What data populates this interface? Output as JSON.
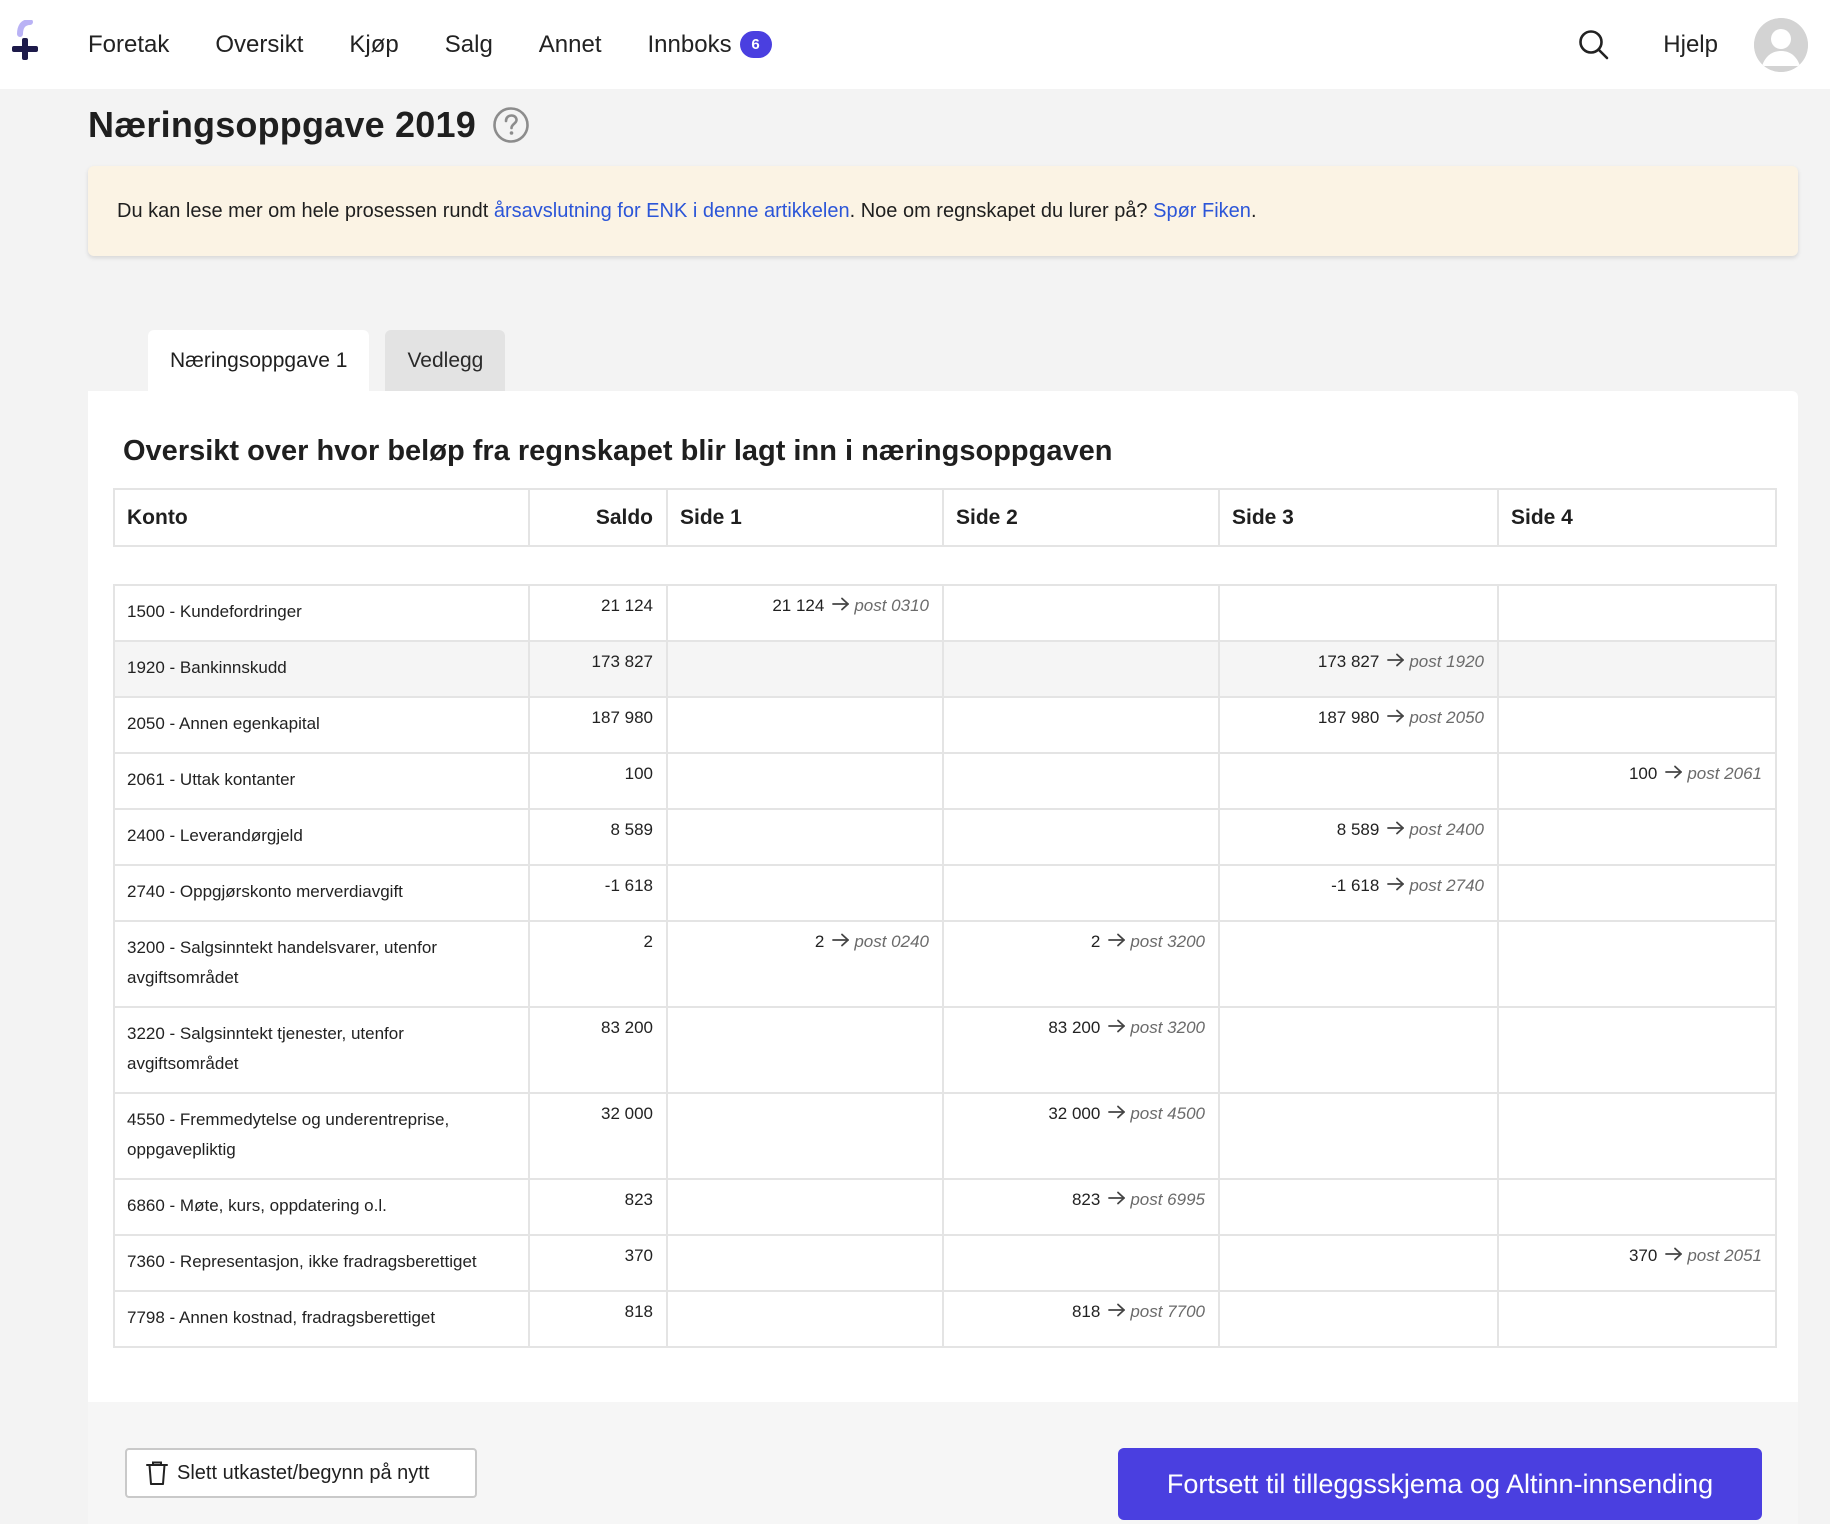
{
  "nav": {
    "items": [
      "Foretak",
      "Oversikt",
      "Kjøp",
      "Salg",
      "Annet"
    ],
    "inbox_label": "Innboks",
    "inbox_count": "6",
    "help_label": "Hjelp"
  },
  "page": {
    "title": "Næringsoppgave 2019"
  },
  "info": {
    "text_before": "Du kan lese mer om hele prosessen rundt ",
    "link1": "årsavslutning for ENK i denne artikkelen",
    "text_middle": ". Noe om regnskapet du lurer på? ",
    "link2": "Spør Fiken",
    "text_after": "."
  },
  "tabs": [
    "Næringsoppgave 1",
    "Vedlegg"
  ],
  "card": {
    "title": "Oversikt over hvor beløp fra regnskapet blir lagt inn i næringsoppgaven"
  },
  "table": {
    "headers": [
      "Konto",
      "Saldo",
      "Side 1",
      "Side 2",
      "Side 3",
      "Side 4"
    ],
    "rows": [
      {
        "konto": "1500 - Kundefordringer",
        "saldo": "21 124",
        "s1": {
          "amount": "21 124",
          "post": "post 0310"
        },
        "s2": null,
        "s3": null,
        "s4": null
      },
      {
        "konto": "1920 - Bankinnskudd",
        "saldo": "173 827",
        "s1": null,
        "s2": null,
        "s3": {
          "amount": "173 827",
          "post": "post 1920"
        },
        "s4": null
      },
      {
        "konto": "2050 - Annen egenkapital",
        "saldo": "187 980",
        "s1": null,
        "s2": null,
        "s3": {
          "amount": "187 980",
          "post": "post 2050"
        },
        "s4": null
      },
      {
        "konto": "2061 - Uttak kontanter",
        "saldo": "100",
        "s1": null,
        "s2": null,
        "s3": null,
        "s4": {
          "amount": "100",
          "post": "post 2061"
        }
      },
      {
        "konto": "2400 - Leverandørgjeld",
        "saldo": "8 589",
        "s1": null,
        "s2": null,
        "s3": {
          "amount": "8 589",
          "post": "post 2400"
        },
        "s4": null
      },
      {
        "konto": "2740 - Oppgjørskonto merverdiavgift",
        "saldo": "-1 618",
        "s1": null,
        "s2": null,
        "s3": {
          "amount": "-1 618",
          "post": "post 2740"
        },
        "s4": null
      },
      {
        "konto": "3200 - Salgsinntekt handelsvarer, utenfor avgiftsområdet",
        "saldo": "2",
        "s1": {
          "amount": "2",
          "post": "post 0240"
        },
        "s2": {
          "amount": "2",
          "post": "post 3200"
        },
        "s3": null,
        "s4": null
      },
      {
        "konto": "3220 - Salgsinntekt tjenester, utenfor avgiftsområdet",
        "saldo": "83 200",
        "s1": null,
        "s2": {
          "amount": "83 200",
          "post": "post 3200"
        },
        "s3": null,
        "s4": null
      },
      {
        "konto": "4550 - Fremmedytelse og underentreprise, oppgavepliktig",
        "saldo": "32 000",
        "s1": null,
        "s2": {
          "amount": "32 000",
          "post": "post 4500"
        },
        "s3": null,
        "s4": null
      },
      {
        "konto": "6860 - Møte, kurs, oppdatering o.l.",
        "saldo": "823",
        "s1": null,
        "s2": {
          "amount": "823",
          "post": "post 6995"
        },
        "s3": null,
        "s4": null
      },
      {
        "konto": "7360 - Representasjon, ikke fradragsberettiget",
        "saldo": "370",
        "s1": null,
        "s2": null,
        "s3": null,
        "s4": {
          "amount": "370",
          "post": "post 2051"
        }
      },
      {
        "konto": "7798 - Annen kostnad, fradragsberettiget",
        "saldo": "818",
        "s1": null,
        "s2": {
          "amount": "818",
          "post": "post 7700"
        },
        "s3": null,
        "s4": null
      }
    ]
  },
  "footer": {
    "delete_label": "Slett utkastet/begynn på nytt",
    "continue_label": "Fortsett til tilleggsskjema og Altinn-innsending"
  },
  "colors": {
    "accent": "#4a3fe0",
    "link": "#2b55d8",
    "info_bg": "#fbf3e4"
  },
  "icons": [
    "fiken-logo-icon",
    "search-icon",
    "avatar-icon",
    "help-circle-icon",
    "arrow-right-icon",
    "trash-icon"
  ]
}
